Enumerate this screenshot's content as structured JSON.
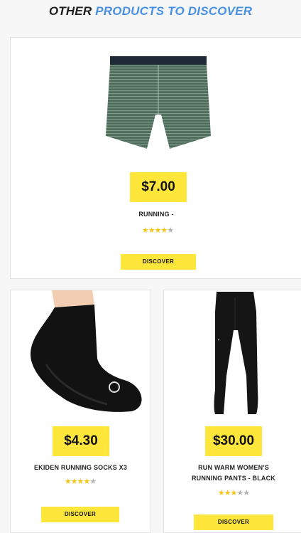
{
  "section": {
    "title_prefix": "OTHER",
    "title_highlight": "PRODUCTS TO DISCOVER"
  },
  "products": [
    {
      "price": "$7.00",
      "name": "RUNNING -",
      "rating": 4.5,
      "button": "DISCOVER",
      "image": "running-boxer-shorts"
    },
    {
      "price": "$4.30",
      "name": "EKIDEN RUNNING SOCKS X3",
      "rating": 4.5,
      "button": "DISCOVER",
      "image": "running-socks"
    },
    {
      "price": "$30.00",
      "name_line1": "RUN WARM WOMEN'S",
      "name_line2": "RUNNING PANTS - BLACK",
      "rating": 3.5,
      "button": "DISCOVER",
      "image": "running-pants"
    }
  ],
  "colors": {
    "accent_yellow": "#ffe63a",
    "title_blue": "#4a90e2",
    "star_gold": "#f5c518"
  }
}
